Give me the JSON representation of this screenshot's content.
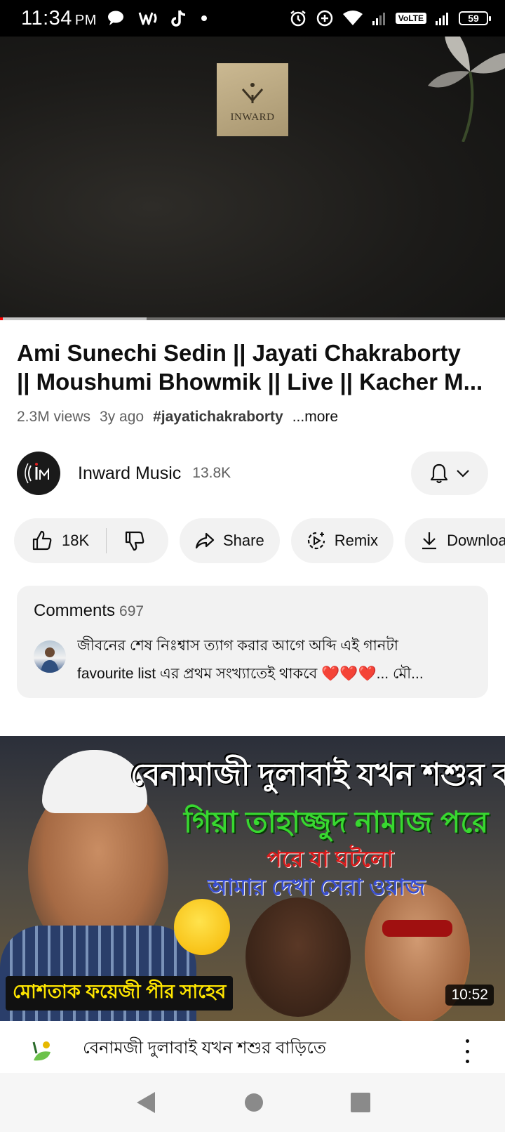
{
  "status_bar": {
    "time": "11:34",
    "ampm": "PM",
    "volte": "VoLTE",
    "battery": "59"
  },
  "player": {
    "logo_text": "INWARD",
    "progress_played": 0.005,
    "progress_buffered": 0.29
  },
  "video": {
    "title_line1": "Ami Sunechi Sedin || Jayati Chakraborty",
    "title_line2": "|| Moushumi Bhowmik || Live || Kacher M...",
    "views": "2.3M views",
    "age": "3y ago",
    "hashtag": "#jayatichakraborty",
    "more": "...more"
  },
  "channel": {
    "name": "Inward Music",
    "subscribers": "13.8K",
    "icon_bell": "bell-icon",
    "icon_chevron": "chevron-down-icon"
  },
  "actions": {
    "likes": "18K",
    "share": "Share",
    "remix": "Remix",
    "download": "Download"
  },
  "comments": {
    "heading": "Comments",
    "count": "697",
    "top_comment_line1": "জীবনের শেষ নিঃশ্বাস ত্যাগ করার আগে অব্দি এই গানটা",
    "top_comment_line2": "favourite list এর প্রথম সংখ্যাতেই থাকবে ❤️❤️❤️... মৌ..."
  },
  "next_video": {
    "thumb_line1": "বেনামাজী দুলাবাই যখন শশুর বাড়িতে",
    "thumb_line2": "গিয়া তাহাজ্জুদ নামাজ পরে",
    "thumb_line3": "পরে যা ঘটলো",
    "thumb_line4": "আমার দেখা সেরা ওয়াজ",
    "thumb_banner": "মোশতাক ফয়েজী পীর সাহেব",
    "duration": "10:52",
    "title": "বেনামজী দুলাবাই যখন শশুর বাড়িতে"
  },
  "colors": {
    "accent_red": "#ff0000",
    "pill_bg": "#f2f2f2",
    "secondary_text": "#606060"
  }
}
